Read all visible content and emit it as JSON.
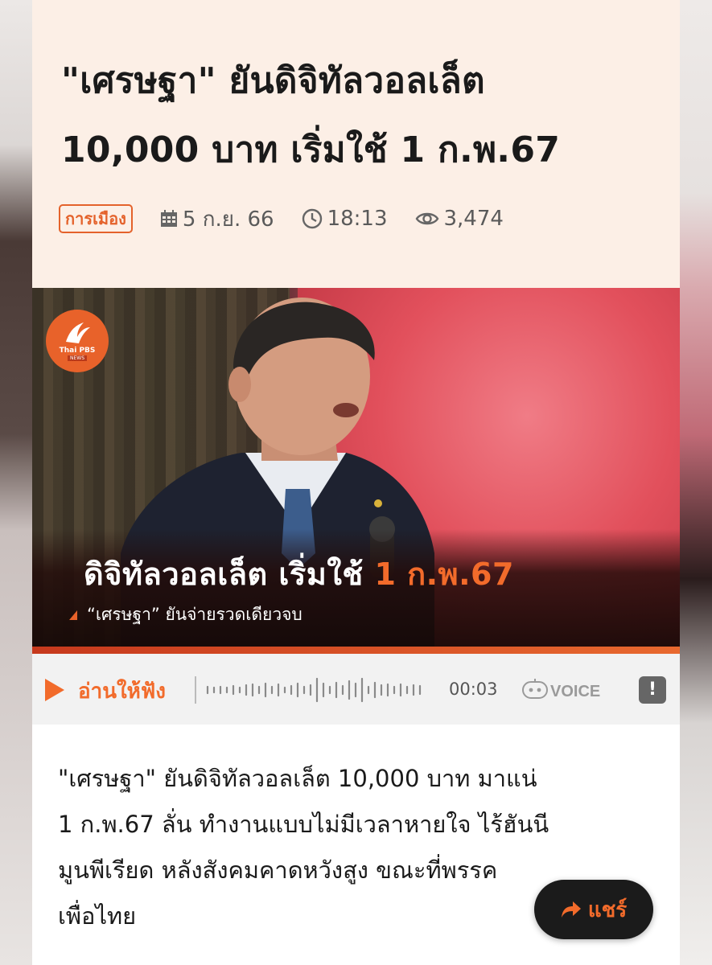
{
  "article": {
    "title_line1": "\"เศรษฐา\" ยันดิจิทัลวอลเล็ต",
    "title_line2": "10,000 บาท เริ่มใช้ 1 ก.พ.67",
    "category": "การเมือง",
    "date": "5 ก.ย. 66",
    "time": "18:13",
    "views": "3,474"
  },
  "hero": {
    "logo_text": "Thai PBS",
    "logo_sub": "NEWS",
    "title_main": "ดิจิทัลวอลเล็ต เริ่มใช้ ",
    "title_accent": "1 ก.พ.67",
    "subtitle": "“เศรษฐา” ยันจ่ายรวดเดียวจบ",
    "accent_color": "#f26b2b"
  },
  "player": {
    "label": "อ่านให้ฟัง",
    "time": "00:03",
    "brand": "VOICE",
    "report_icon": "!"
  },
  "body": {
    "line1": "\"เศรษฐา\" ยันดิจิทัลวอลเล็ต 10,000 บาท มาแน่",
    "line2": "1 ก.พ.67 ลั่น ทำงานแบบไม่มีเวลาหายใจ ไร้ฮันนี",
    "line3": "มูนพีเรียด หลังสังคมคาดหวังสูง ขณะที่พรรค",
    "line4": "เพื่อไทย"
  },
  "share": {
    "label": "แชร์",
    "icon": "share-arrow-icon"
  }
}
